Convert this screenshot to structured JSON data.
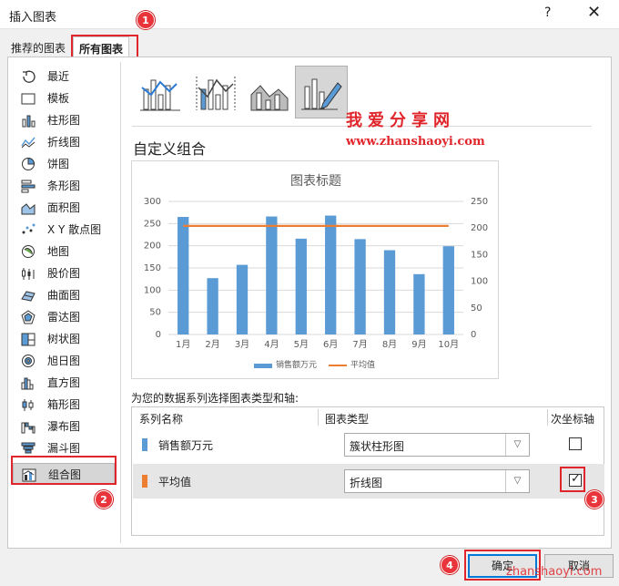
{
  "window": {
    "title": "插入图表",
    "help": "?",
    "close": "✕"
  },
  "tabs": [
    {
      "label": "推荐的图表"
    },
    {
      "label": "所有图表"
    }
  ],
  "sidebar": {
    "items": [
      {
        "label": "最近",
        "icon": "recent-icon"
      },
      {
        "label": "模板",
        "icon": "folder-icon"
      },
      {
        "label": "柱形图",
        "icon": "column-chart-icon"
      },
      {
        "label": "折线图",
        "icon": "line-chart-icon"
      },
      {
        "label": "饼图",
        "icon": "pie-chart-icon"
      },
      {
        "label": "条形图",
        "icon": "bar-chart-icon"
      },
      {
        "label": "面积图",
        "icon": "area-chart-icon"
      },
      {
        "label": "X Y 散点图",
        "icon": "scatter-chart-icon"
      },
      {
        "label": "地图",
        "icon": "map-chart-icon"
      },
      {
        "label": "股价图",
        "icon": "stock-chart-icon"
      },
      {
        "label": "曲面图",
        "icon": "surface-chart-icon"
      },
      {
        "label": "雷达图",
        "icon": "radar-chart-icon"
      },
      {
        "label": "树状图",
        "icon": "treemap-chart-icon"
      },
      {
        "label": "旭日图",
        "icon": "sunburst-chart-icon"
      },
      {
        "label": "直方图",
        "icon": "histogram-chart-icon"
      },
      {
        "label": "箱形图",
        "icon": "box-chart-icon"
      },
      {
        "label": "瀑布图",
        "icon": "waterfall-chart-icon"
      },
      {
        "label": "漏斗图",
        "icon": "funnel-chart-icon"
      },
      {
        "label": "组合图",
        "icon": "combo-chart-icon",
        "selected": true
      }
    ]
  },
  "subtypes": [
    "combo-column-line-icon",
    "combo-column-line-secondary-icon",
    "combo-area-column-icon",
    "custom-combo-icon"
  ],
  "section_title": "自定义组合",
  "watermark": {
    "cn": "我爱分享网",
    "url": "www.zhanshaoyi.com",
    "bottom": "zhanshaoyi.com"
  },
  "badges": [
    "1",
    "2",
    "3",
    "4"
  ],
  "chart_data": {
    "type": "bar",
    "title": "图表标题",
    "categories": [
      "1月",
      "2月",
      "3月",
      "4月",
      "5月",
      "6月",
      "7月",
      "8月",
      "9月",
      "10月"
    ],
    "series": [
      {
        "name": "销售额万元",
        "type": "bar",
        "axis": "primary",
        "color": "#5b9bd5",
        "values": [
          265,
          127,
          157,
          266,
          216,
          268,
          215,
          190,
          136,
          199
        ]
      },
      {
        "name": "平均值",
        "type": "line",
        "axis": "secondary",
        "color": "#ed7d31",
        "values": [
          204,
          204,
          204,
          204,
          204,
          204,
          204,
          204,
          204,
          204
        ]
      }
    ],
    "ylim": [
      0,
      300
    ],
    "yticks": [
      "0",
      "50",
      "100",
      "150",
      "200",
      "250",
      "300"
    ],
    "y2lim": [
      0,
      250
    ],
    "y2ticks": [
      "0",
      "50",
      "100",
      "150",
      "200",
      "250"
    ],
    "legend": "bottom"
  },
  "series_section": {
    "label": "为您的数据系列选择图表类型和轴:",
    "headers": {
      "name": "系列名称",
      "type": "图表类型",
      "axis": "次坐标轴"
    },
    "rows": [
      {
        "name": "销售额万元",
        "type": "簇状柱形图",
        "secondary": false,
        "color": "#5b9bd5"
      },
      {
        "name": "平均值",
        "type": "折线图",
        "secondary": true,
        "color": "#ed7d31"
      }
    ]
  },
  "buttons": {
    "ok": "确定",
    "cancel": "取消"
  }
}
